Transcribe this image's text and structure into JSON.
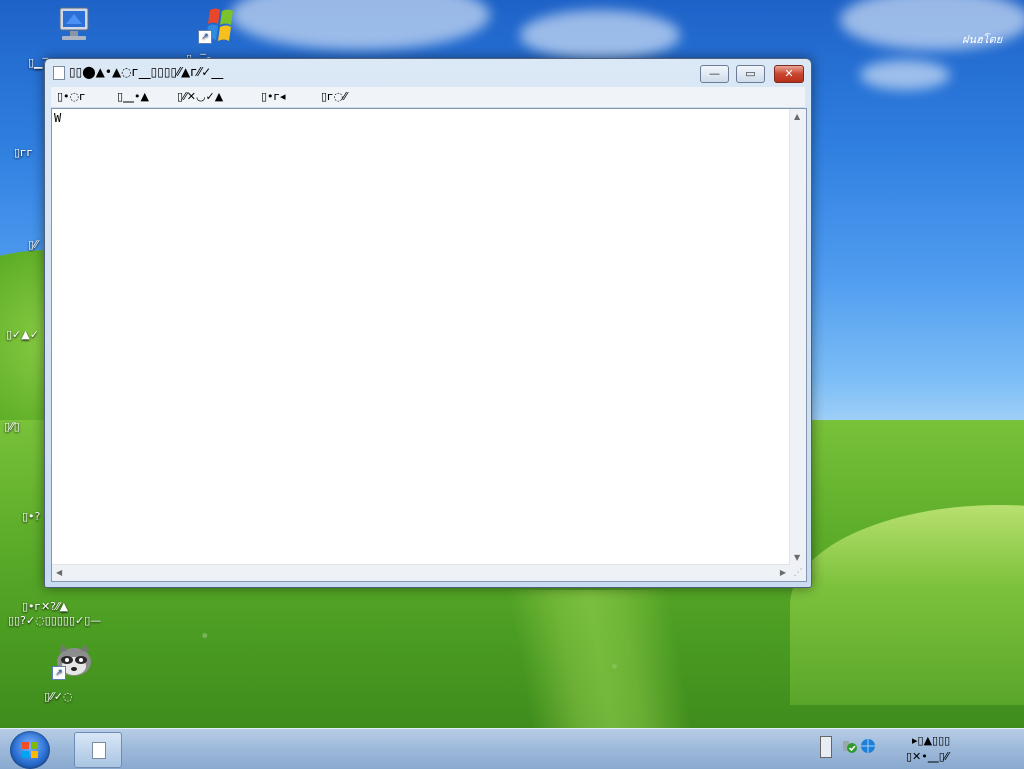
{
  "desktop": {
    "watermark": "ฝนฮโตย",
    "icons": [
      {
        "name": "computer",
        "label": "▯▁‾⁃"
      },
      {
        "name": "windows-shortcut",
        "label": "▯▁‾⁃"
      },
      {
        "name": "raccoon-shortcut",
        "label": "▯⁄⁄✓◌"
      }
    ],
    "side_labels": [
      "▯ᴦᴦ",
      "▯⁄⁄",
      "▯✓▲✓",
      "▯⁄⁄▯",
      "▯•?",
      "▯•ᴦ✕?⁄⁄▲",
      "▯▯?✓◌▯▯▯▯▯✓▯—"
    ]
  },
  "window": {
    "title": "▯▯⬤▲•▲◌ᴦ⎽▯▯▯▯⁄⁄▲ᴦ⁄⁄✓⎽",
    "buttons": {
      "minimize": "—",
      "maximize": "▭",
      "close": "✕"
    },
    "menu": [
      "▯•◌ᴦ",
      "▯⎽•▲",
      "▯⁄⁄✕◡✓▲",
      "▯•ᴦ◂",
      "▯ᴦ◌⁄⁄"
    ],
    "editor_text": "W"
  },
  "taskbar": {
    "tray_line1": "▸▯▲▯▯▯",
    "tray_line2": "▯✕•⎽▯⁄⁄"
  }
}
